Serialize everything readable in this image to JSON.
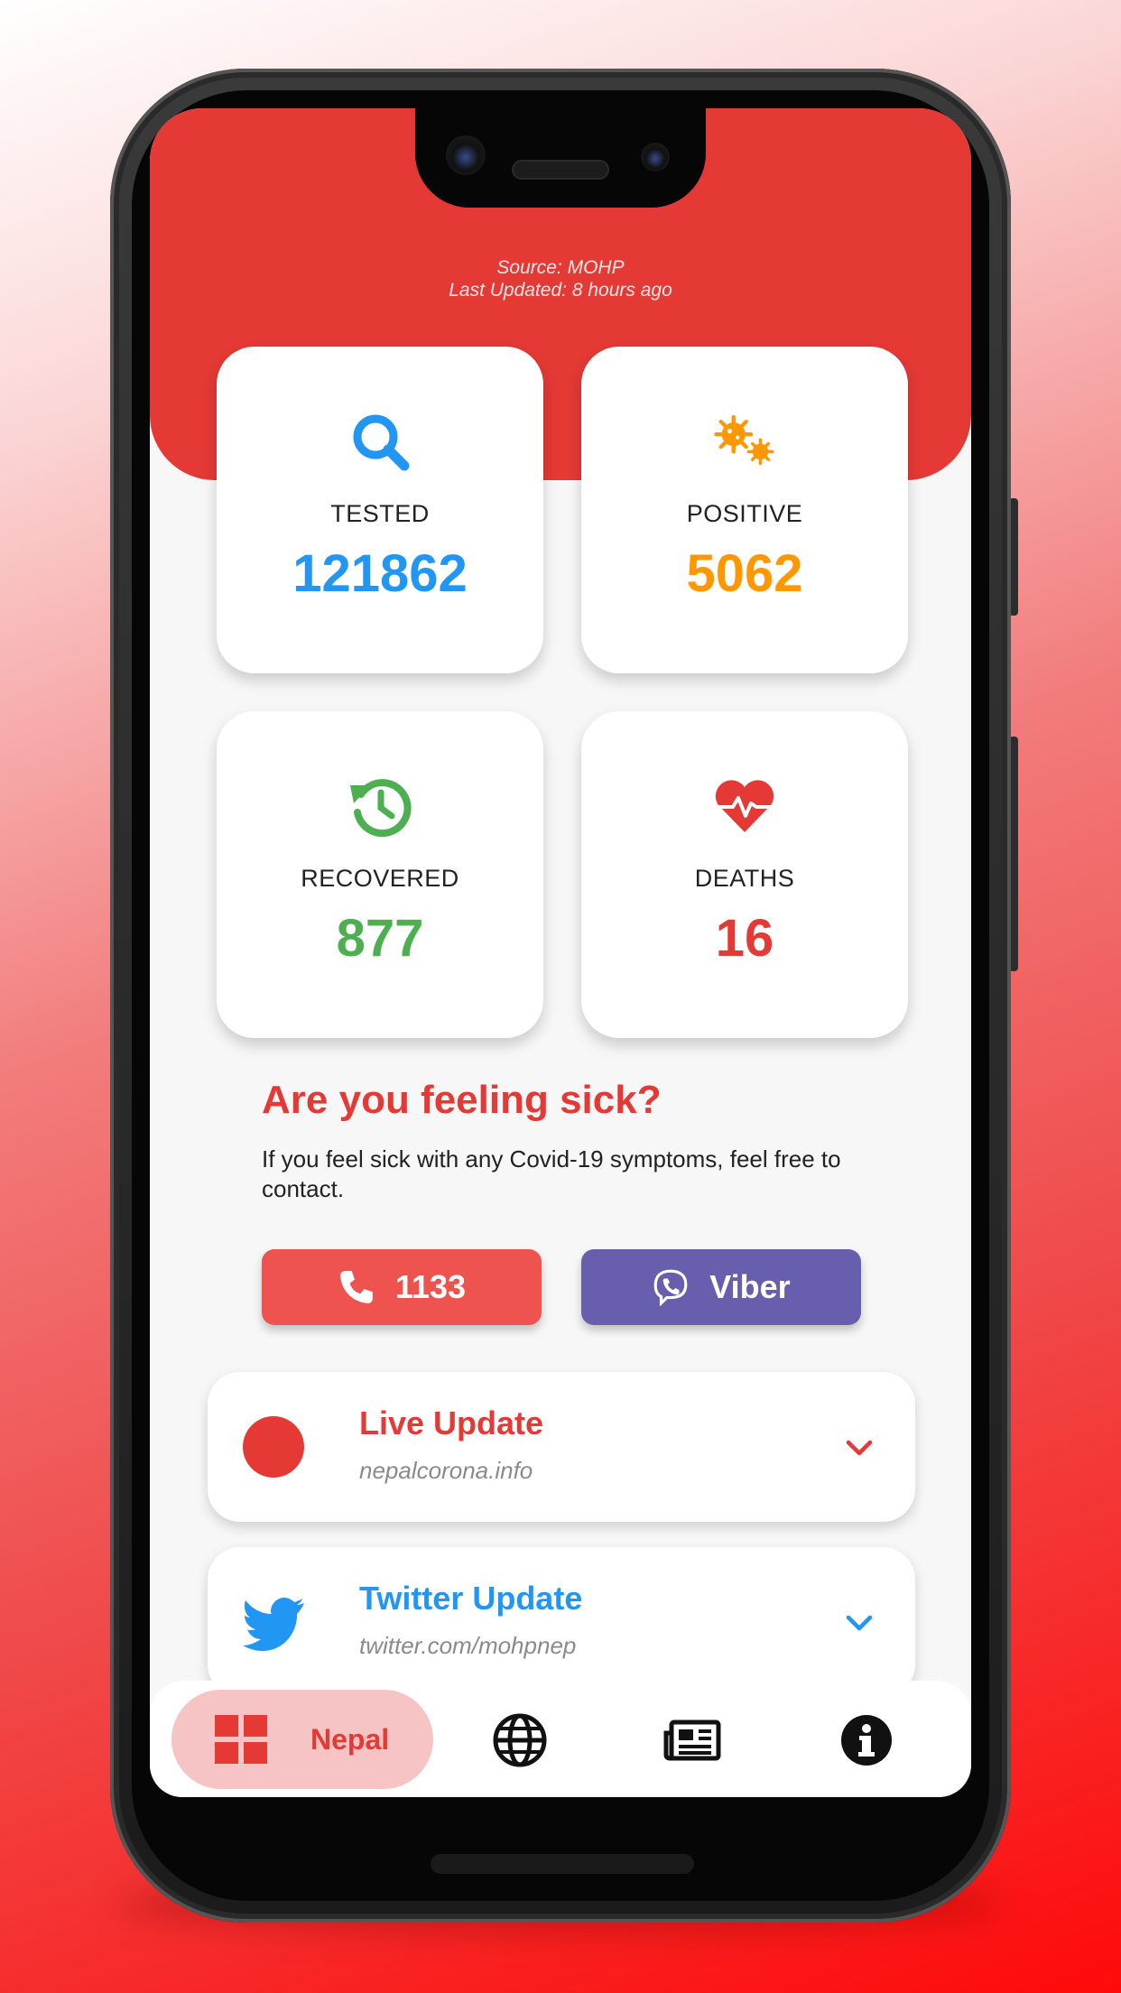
{
  "header": {
    "source": "Source: MOHP",
    "last_updated": "Last Updated: 8 hours ago"
  },
  "stats": [
    {
      "label": "TESTED",
      "value": "121862",
      "color": "#2196f3",
      "icon": "search-icon"
    },
    {
      "label": "POSITIVE",
      "value": "5062",
      "color": "#ff9800",
      "icon": "virus-icon"
    },
    {
      "label": "RECOVERED",
      "value": "877",
      "color": "#4caf50",
      "icon": "history-icon"
    },
    {
      "label": "DEATHS",
      "value": "16",
      "color": "#e53935",
      "icon": "heartbeat-icon"
    }
  ],
  "sick": {
    "title": "Are you feeling sick?",
    "text": "If you feel sick with any Covid-19 symptoms, feel free to contact."
  },
  "buttons": {
    "call_label": "1133",
    "viber_label": "Viber"
  },
  "updates": [
    {
      "title": "Live Update",
      "subtitle": "nepalcorona.info",
      "color": "#e53935",
      "icon": "live-dot-icon"
    },
    {
      "title": "Twitter Update",
      "subtitle": "twitter.com/mohpnep",
      "color": "#2196f3",
      "icon": "twitter-icon"
    }
  ],
  "nav": {
    "active_label": "Nepal",
    "items": [
      "dashboard-icon",
      "globe-icon",
      "newspaper-icon",
      "info-icon"
    ]
  },
  "colors": {
    "primary": "#e53935",
    "viber": "#675fad"
  }
}
